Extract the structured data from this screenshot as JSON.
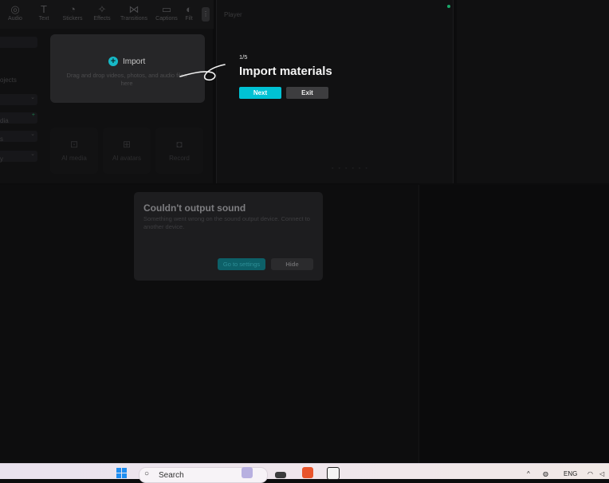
{
  "toolbar": {
    "tools": [
      {
        "label": "Audio",
        "icon": "audio-icon"
      },
      {
        "label": "Text",
        "icon": "text-icon"
      },
      {
        "label": "Stickers",
        "icon": "stickers-icon"
      },
      {
        "label": "Effects",
        "icon": "effects-icon"
      },
      {
        "label": "Transitions",
        "icon": "transitions-icon"
      },
      {
        "label": "Captions",
        "icon": "captions-icon"
      },
      {
        "label": "Filt",
        "icon": "filters-icon"
      }
    ]
  },
  "sidebar": {
    "items": [
      "ojects",
      "dia",
      "s",
      "y"
    ]
  },
  "media": {
    "import_label": "Import",
    "import_description": "Drag and drop videos, photos, and audio files here",
    "tiles": [
      "AI media",
      "AI avatars",
      "Record"
    ]
  },
  "player": {
    "title": "Player"
  },
  "tour": {
    "step": "1/5",
    "title": "Import materials",
    "next_label": "Next",
    "exit_label": "Exit"
  },
  "dialog": {
    "title": "Couldn't output sound",
    "message": "Something went wrong on the sound output device. Connect to another device.",
    "settings_label": "Go to settings",
    "hide_label": "Hide"
  },
  "taskbar": {
    "search_placeholder": "Search",
    "language": "ENG"
  },
  "colors": {
    "accent": "#00c2d4",
    "background": "#0c0c0d"
  }
}
